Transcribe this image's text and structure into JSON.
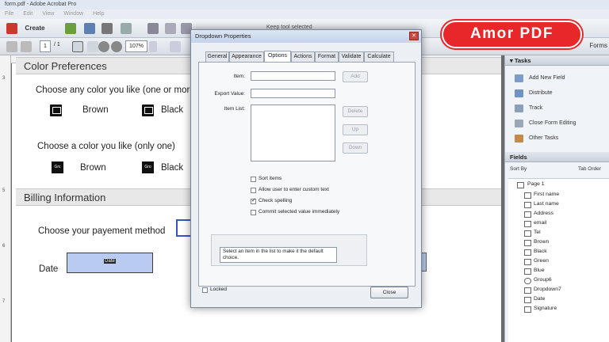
{
  "window": {
    "title": "form.pdf - Adobe Acrobat Pro"
  },
  "menu": [
    "File",
    "Edit",
    "View",
    "Window",
    "Help"
  ],
  "toolbar": {
    "create_label": "Create",
    "page_current": "1",
    "page_total": "1",
    "zoom": "107%",
    "keep_tool": "Keep tool selected",
    "forms_label": "Forms"
  },
  "document": {
    "section1_title": "Color Preferences",
    "q1": "Choose any color you like (one or more)",
    "q1_opt1": "Brown",
    "q1_opt2": "Black",
    "q2": "Choose a color you like (only one)",
    "q2_opt1": "Brown",
    "q2_opt2": "Black",
    "q2_icon1": "Grc",
    "q2_icon2": "Gro",
    "section2_title": "Billing Information",
    "q3": "Choose your payement method",
    "date_label": "Date",
    "date_field": "Date"
  },
  "dialog": {
    "title": "Dropdown Properties",
    "tabs": [
      "General",
      "Appearance",
      "Options",
      "Actions",
      "Format",
      "Validate",
      "Calculate"
    ],
    "active_tab": "Options",
    "item_label": "Item:",
    "export_label": "Export Value:",
    "item_list_label": "Item List:",
    "add_btn": "Add",
    "delete_btn": "Delete",
    "up_btn": "Up",
    "down_btn": "Down",
    "checkboxes": [
      {
        "label": "Sort items",
        "checked": false
      },
      {
        "label": "Allow user to enter custom text",
        "checked": false
      },
      {
        "label": "Check spelling",
        "checked": true
      },
      {
        "label": "Commit selected value immediately",
        "checked": false
      }
    ],
    "hint": "Select an item in the list to make it the default choice.",
    "locked_label": "Locked",
    "close_btn": "Close"
  },
  "tasks": {
    "header": "Tasks",
    "items": [
      "Add New Field",
      "Distribute",
      "Track",
      "Close Form Editing",
      "Other Tasks"
    ]
  },
  "fields": {
    "header": "Fields",
    "sort_label": "Sort By",
    "tab_order_label": "Tab Order",
    "root": "Page 1",
    "items": [
      "First name",
      "Last name",
      "Address",
      "email",
      "Tel",
      "Brown",
      "Black",
      "Green",
      "Blue",
      "Group6",
      "Dropdown7",
      "Date",
      "Signature"
    ]
  },
  "watermark": {
    "text": "Amor PDF"
  },
  "colors": {
    "logo_red": "#e8272a",
    "field_blue": "#b9cbf1"
  }
}
